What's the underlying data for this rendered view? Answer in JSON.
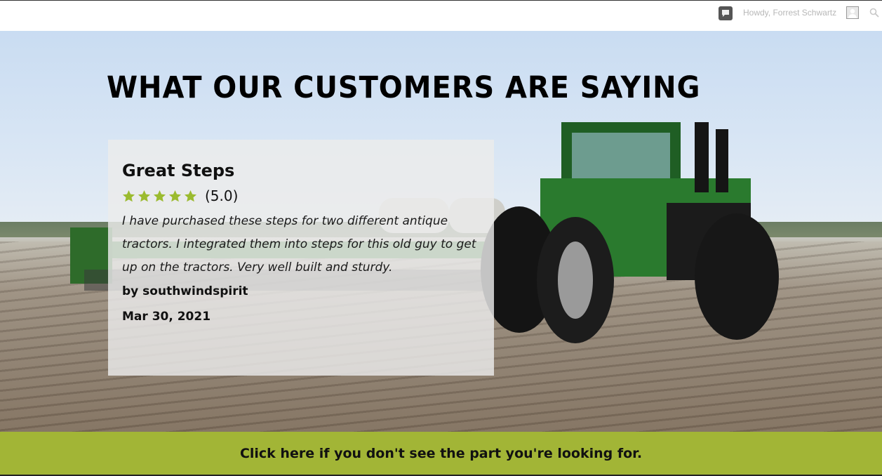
{
  "admin_bar": {
    "greeting": "Howdy, Forrest Schwartz",
    "comments_icon": "comment-bubble-icon",
    "search_icon": "search-icon"
  },
  "hero": {
    "title": "What our customers are saying"
  },
  "review": {
    "title": "Great Steps",
    "stars": 5,
    "rating_text": "(5.0)",
    "body": "I have purchased these steps for two different antique tractors. I integrated them into steps for this old guy to get up on the tractors. Very well built and sturdy.",
    "author": "by southwindspirit",
    "date": "Mar 30, 2021"
  },
  "cta": {
    "label": "Click here if you don't see the part you're looking for."
  },
  "colors": {
    "accent_green": "#a2b536",
    "star_green": "#9bbb2f"
  }
}
